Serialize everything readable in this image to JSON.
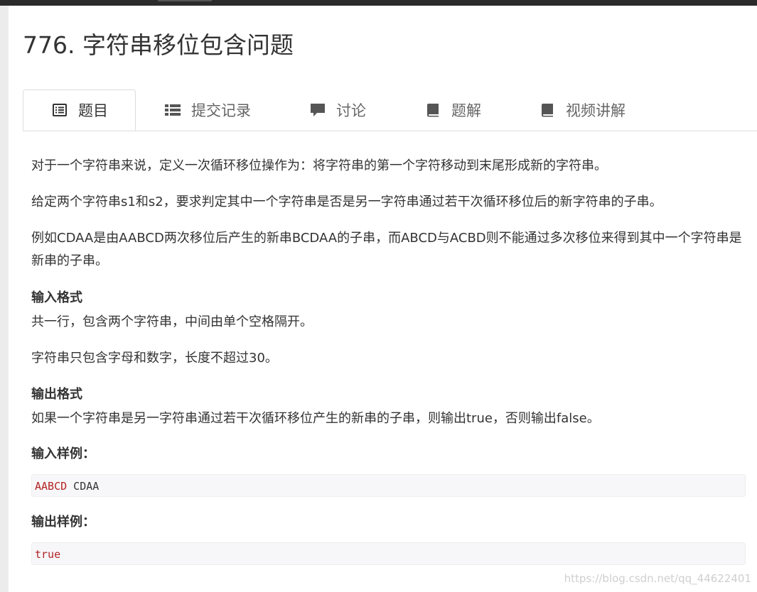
{
  "problem": {
    "title": "776. 字符串移位包含问题"
  },
  "tabs": [
    {
      "label": "题目",
      "icon": "list-alt-icon"
    },
    {
      "label": "提交记录",
      "icon": "th-list-icon"
    },
    {
      "label": "讨论",
      "icon": "comment-icon"
    },
    {
      "label": "题解",
      "icon": "book-icon"
    },
    {
      "label": "视频讲解",
      "icon": "book-icon"
    }
  ],
  "description": {
    "p1": "对于一个字符串来说，定义一次循环移位操作为：将字符串的第一个字符移动到末尾形成新的字符串。",
    "p2": "给定两个字符串s1和s2，要求判定其中一个字符串是否是另一字符串通过若干次循环移位后的新字符串的子串。",
    "p3": "例如CDAA是由AABCD两次移位后产生的新串BCDAA的子串，而ABCD与ACBD则不能通过多次移位来得到其中一个字符串是新串的子串。"
  },
  "input_format": {
    "heading": "输入格式",
    "p1": "共一行，包含两个字符串，中间由单个空格隔开。",
    "p2": "字符串只包含字母和数字，长度不超过30。"
  },
  "output_format": {
    "heading": "输出格式",
    "p1": "如果一个字符串是另一字符串通过若干次循环移位产生的新串的子串，则输出true，否则输出false。"
  },
  "sample_input": {
    "heading": "输入样例：",
    "token1": "AABCD",
    "token2": " CDAA"
  },
  "sample_output": {
    "heading": "输出样例：",
    "value": "true"
  },
  "watermark": "https://blog.csdn.net/qq_44622401",
  "colors": {
    "text": "#333333",
    "tab_inactive": "#666666",
    "code_token": "#b22222",
    "code_bg": "#f7f7f9",
    "border": "#dddddd"
  }
}
